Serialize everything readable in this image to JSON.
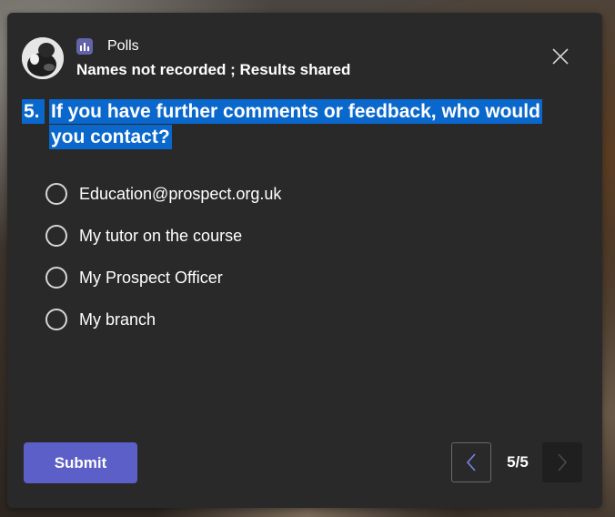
{
  "poll": {
    "app_name": "Polls",
    "subtitle": "Names not recorded ; Results shared",
    "question_number": "5.",
    "question_text": "If you have further comments or feedback, who would you contact?",
    "options": [
      "Education@prospect.org.uk",
      "My tutor on the course",
      "My Prospect Officer",
      "My branch"
    ],
    "submit_label": "Submit",
    "pager": "5/5"
  },
  "colors": {
    "card_bg": "#292929",
    "accent": "#5b5fc7",
    "app_icon": "#6264a7",
    "selection_highlight": "#0a68cc"
  },
  "icons": {
    "avatar": "user-avatar-icon",
    "app": "polls-app-icon",
    "close": "close-icon",
    "prev": "chevron-left-icon",
    "next": "chevron-right-icon"
  }
}
